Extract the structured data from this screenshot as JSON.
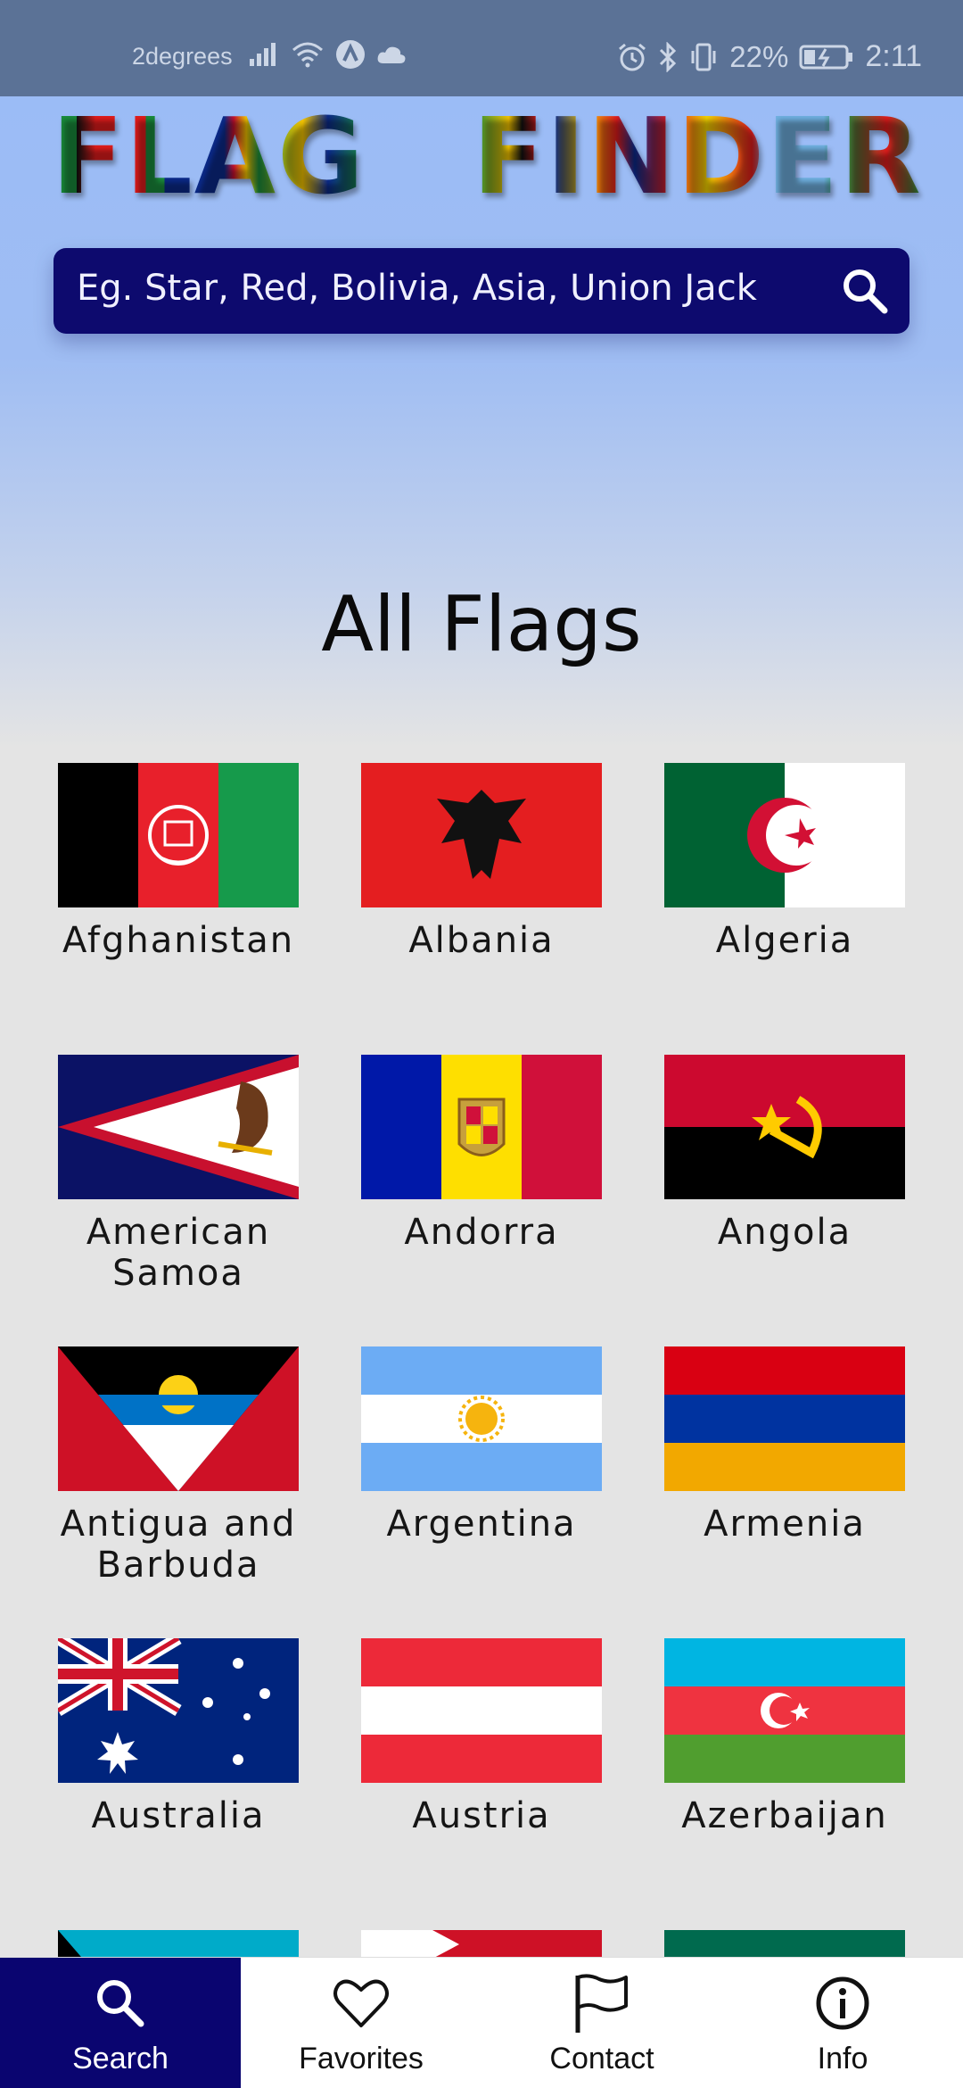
{
  "status_bar": {
    "carrier": "2degrees",
    "battery": "22%",
    "time": "2:11"
  },
  "header": {
    "logo_word_1": "FLAG",
    "logo_word_2": "FINDER"
  },
  "search": {
    "placeholder": "Eg. Star, Red, Bolivia, Asia, Union Jack"
  },
  "section_title": "All Flags",
  "flags": [
    {
      "name": "Afghanistan"
    },
    {
      "name": "Albania"
    },
    {
      "name": "Algeria"
    },
    {
      "name": "American Samoa"
    },
    {
      "name": "Andorra"
    },
    {
      "name": "Angola"
    },
    {
      "name": "Antigua and Barbuda"
    },
    {
      "name": "Argentina"
    },
    {
      "name": "Armenia"
    },
    {
      "name": "Australia"
    },
    {
      "name": "Austria"
    },
    {
      "name": "Azerbaijan"
    }
  ],
  "nav": [
    {
      "label": "Search",
      "icon": "search-icon",
      "active": true
    },
    {
      "label": "Favorites",
      "icon": "heart-icon",
      "active": false
    },
    {
      "label": "Contact",
      "icon": "flag-icon",
      "active": false
    },
    {
      "label": "Info",
      "icon": "info-icon",
      "active": false
    }
  ],
  "colors": {
    "accent": "#0a0570",
    "status_bar": "#5b7296",
    "hero_top": "#9bbcf6",
    "page_bg": "#e4e4e4"
  }
}
